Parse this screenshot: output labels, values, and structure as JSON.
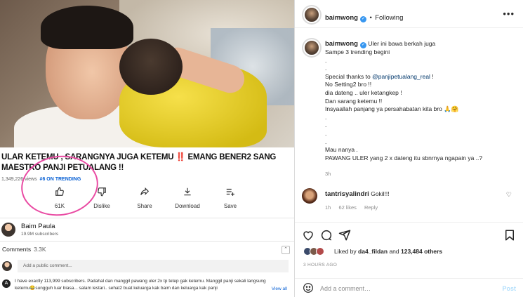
{
  "youtube": {
    "title_part1": "ULAR KETEMU , SARANGNYA JUGA KETEMU ",
    "title_flag": "‼️",
    "title_part2": " EMANG BENER2 SANG MAESTRO PANJI PETUALANG !!",
    "views": "1,349,226 views",
    "trending": "#6 ON TRENDING",
    "actions": [
      {
        "icon": "thumbs-up-icon",
        "label": "61K"
      },
      {
        "icon": "thumbs-down-icon",
        "label": "Dislike"
      },
      {
        "icon": "share-icon",
        "label": "Share"
      },
      {
        "icon": "download-icon",
        "label": "Download"
      },
      {
        "icon": "save-icon",
        "label": "Save"
      }
    ],
    "channel_name": "Baim Paula",
    "channel_subs": "19.9M subscribers",
    "comments_label": "Comments",
    "comments_count": "3.3K",
    "add_comment_placeholder": "Add a public comment...",
    "top_comment_avatar_letter": "A",
    "top_comment": "I have exactly 113,999 subscribers. Padahal dan manggil pawang uler 2x tp tetep gak ketemu. Manggil panji sekali langsung ketemu😂sungguh luar biasa... salam lestari.. sehat2 buat keluarga kak baim dan keluarga kak panji",
    "view_all": "View all"
  },
  "instagram": {
    "username": "baimwong",
    "follow_dot": "•",
    "follow_status": "Following",
    "more": "•••",
    "caption_line1": " Uler ini bawa berkah juga",
    "caption_line2": "Sampe 3 trending begini",
    "caption_dots1": ".\n.",
    "caption_thanks": "Special thanks to ",
    "mention": "@panjipetualang_real",
    "caption_thanks_end": " !",
    "caption_body": "No Setting2 bro !!\ndia dateng .. uler ketangkep !\nDan sarang ketemu !!\nInsyaallah panjang ya persahabatan kita bro 🙏🤗\n.\n.\n.\n.",
    "caption_end": "Mau nanya .\nPAWANG ULER yang 2 x dateng itu sbnrnya ngapain ya ..?",
    "caption_time": "3h",
    "reply_user": "tantrisyalindri",
    "reply_text": "Gokil!!!",
    "reply_time": "1h",
    "reply_likes": "62 likes",
    "reply_action": "Reply",
    "liked_by_prefix": "Liked by ",
    "liked_by_user": "da4_fildan",
    "liked_by_and": " and ",
    "liked_by_count": "123,484 others",
    "time_ago": "3 HOURS AGO",
    "comment_placeholder": "Add a comment…",
    "post_label": "Post"
  }
}
